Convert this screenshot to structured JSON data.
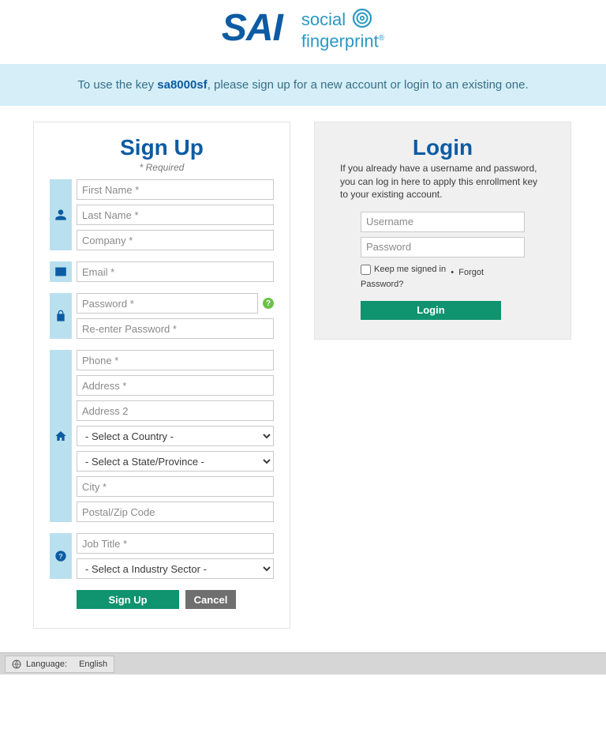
{
  "brand": {
    "sai": "SAI",
    "sf_top": "social",
    "sf_bottom": "fingerprint",
    "sf_reg": "®"
  },
  "banner": {
    "prefix": "To use the key ",
    "key": "sa8000sf",
    "suffix": ", please sign up for a new account or login to an existing one."
  },
  "signup": {
    "title": "Sign Up",
    "required": "* Required",
    "first_name_ph": "First Name *",
    "last_name_ph": "Last Name *",
    "company_ph": "Company *",
    "email_ph": "Email *",
    "password_ph": "Password *",
    "reenter_ph": "Re-enter Password *",
    "phone_ph": "Phone *",
    "address_ph": "Address *",
    "address2_ph": "Address 2",
    "country_ph": "- Select a Country -",
    "state_ph": "- Select a State/Province -",
    "city_ph": "City *",
    "postal_ph": "Postal/Zip Code",
    "jobtitle_ph": "Job Title *",
    "industry_ph": "- Select a Industry Sector -",
    "signup_btn": "Sign Up",
    "cancel_btn": "Cancel"
  },
  "login": {
    "title": "Login",
    "intro": "If you already have a username and password, you can log in here to apply this enrollment key to your existing account.",
    "username_ph": "Username",
    "password_ph": "Password",
    "stay_label": "Keep me signed in",
    "sep": "•",
    "forgot": "Forgot Password?",
    "login_btn": "Login"
  },
  "footer": {
    "language_label": "Language:",
    "language_value": "English"
  }
}
